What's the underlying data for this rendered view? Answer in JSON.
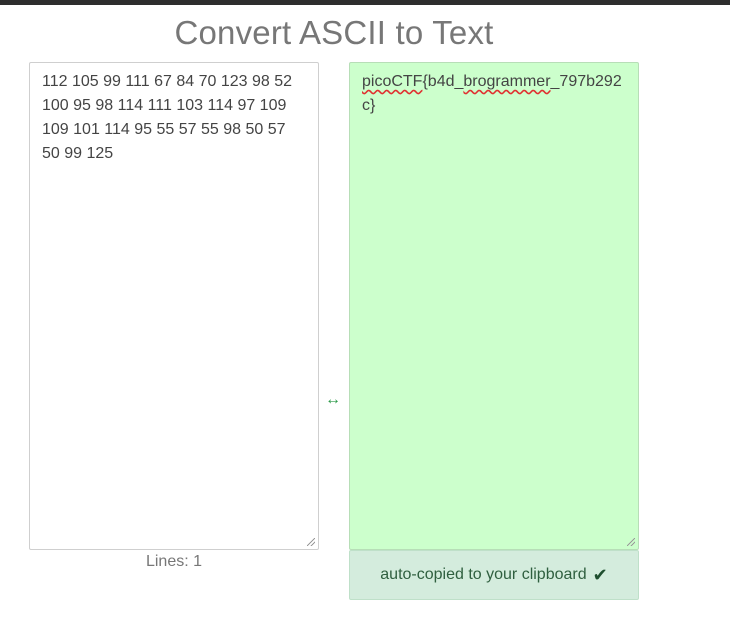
{
  "page": {
    "title": "Convert ASCII to Text"
  },
  "input": {
    "value": "112 105 99 111 67 84 70 123 98 52 100 95 98 114 111 103 114 97 109 109 101 114 95 55 57 55 98 50 57 50 99 125"
  },
  "output": {
    "segments": [
      "picoCTF",
      "{b4d_",
      "brogrammer",
      "_797b292c}"
    ]
  },
  "status": {
    "lines_label": "Lines: 1",
    "copied_label": "auto-copied to your clipboard"
  },
  "icons": {
    "swap": "double-arrow-icon",
    "check": "checkmark-icon"
  },
  "colors": {
    "output_bg": "#ccffcc",
    "copied_bg": "#d4ecdd",
    "accent": "#2e9a4a"
  }
}
